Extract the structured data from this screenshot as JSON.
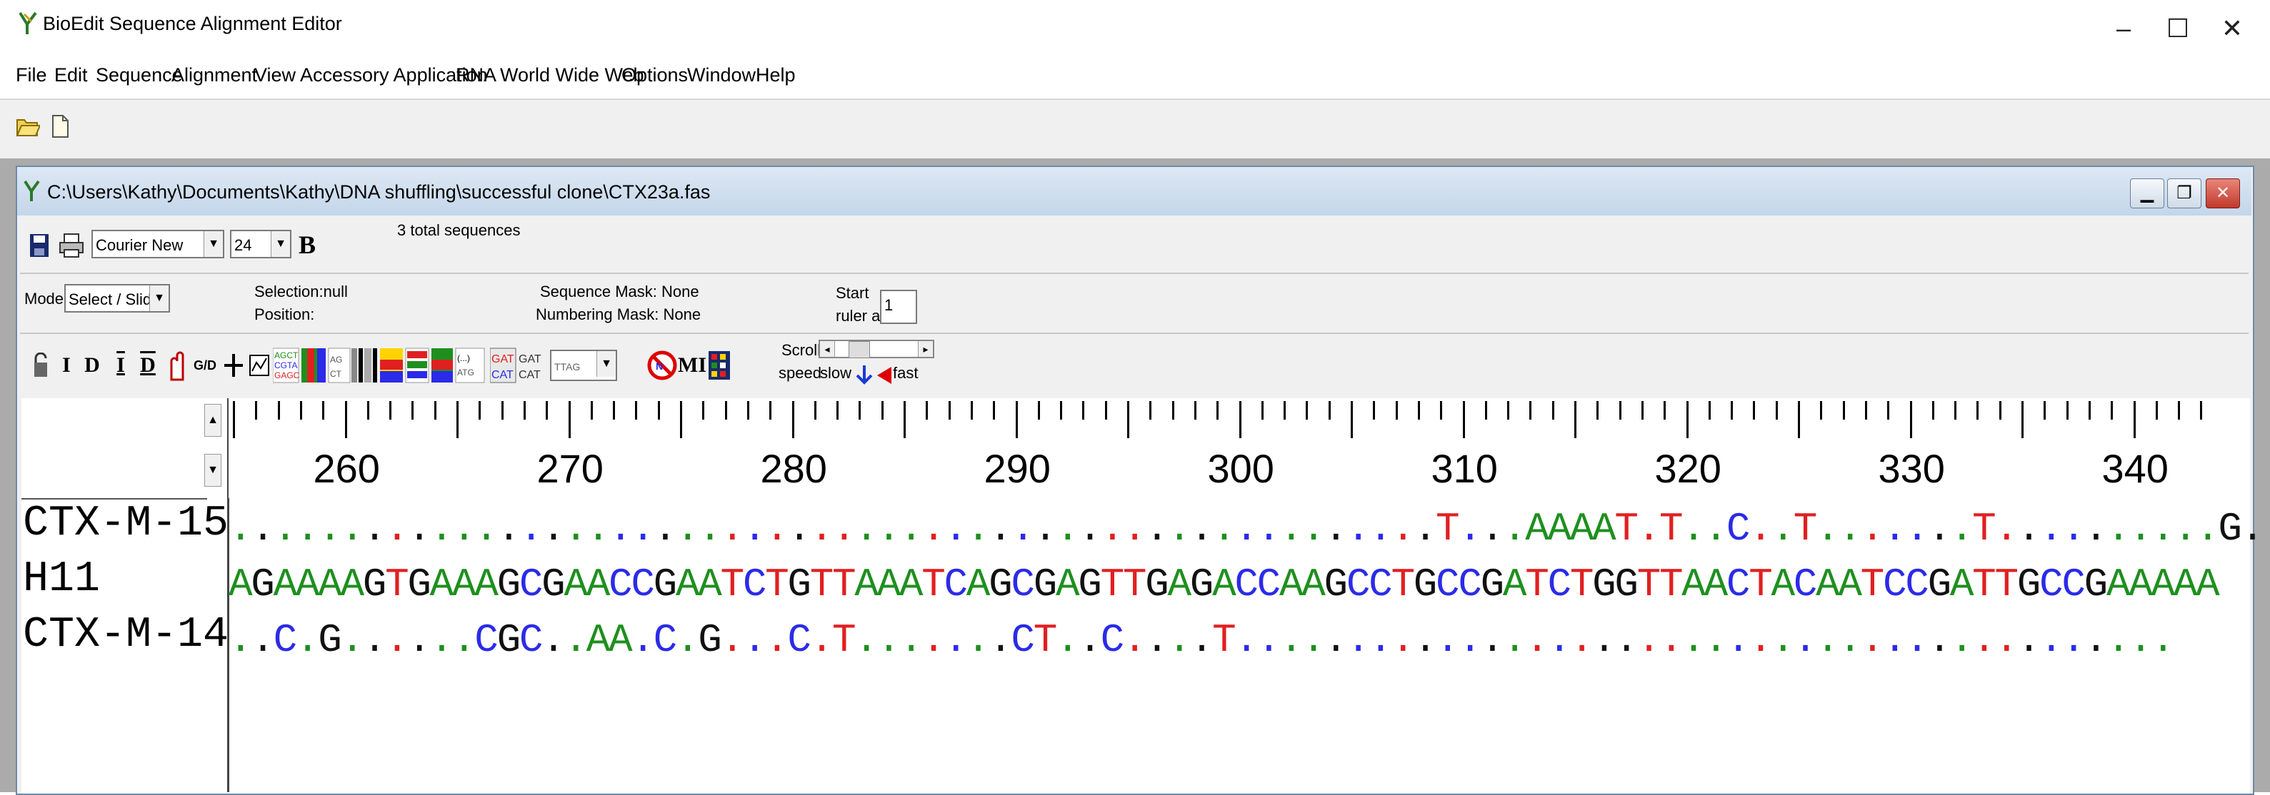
{
  "app": {
    "title": "BioEdit Sequence Alignment Editor",
    "minimize": "–",
    "maximize": "☐",
    "close": "✕"
  },
  "menu": [
    "File",
    "Edit",
    "Sequence",
    "Alignment",
    "View",
    "Accessory Application",
    "RNA",
    "World Wide Web",
    "Options",
    "Window",
    "Help"
  ],
  "child": {
    "title": "C:\\Users\\Kathy\\Documents\\Kathy\\DNA shuffling\\successful clone\\CTX23a.fas",
    "total_sequences": "3 total sequences",
    "font_name": "Courier New",
    "font_size": "24",
    "bold": "B",
    "mode_label": "Mode:",
    "mode_value": "Select / Slide",
    "selection": "Selection:null",
    "position": "Position:",
    "sequence_mask": "Sequence Mask: None",
    "numbering_mask": "Numbering Mask: None",
    "start_label": "Start",
    "ruler_at_label": "ruler at:",
    "ruler_at_value": "1",
    "scroll_label": "Scroll",
    "speed_label": "speed",
    "slow_label": "slow",
    "fast_label": "fast",
    "toolbar_letters": [
      "I",
      "D",
      "I",
      "D",
      "G/D",
      "MI"
    ]
  },
  "ruler": {
    "labels": [
      "260",
      "270",
      "280",
      "290",
      "300",
      "310",
      "320",
      "330",
      "340"
    ]
  },
  "sequences": [
    {
      "name": "CTX-M-15",
      "seq": "......................................................T...AAAAT.T..C..T.......T..........G.....G"
    },
    {
      "name": "H11",
      "seq": "AGAAAAGTGAAAGCGAACCGAATCTGTTAAATCAGCGAGTTGAGACCAAGCCTGCCGATCTGGTTAACTACAATCCGATTGCCGAAAAA"
    },
    {
      "name": "CTX-M-14",
      "seq": "..C.G......CGC..AA.C.G...C.T.......CT..C....T.........................................."
    }
  ],
  "reference_index": 1
}
